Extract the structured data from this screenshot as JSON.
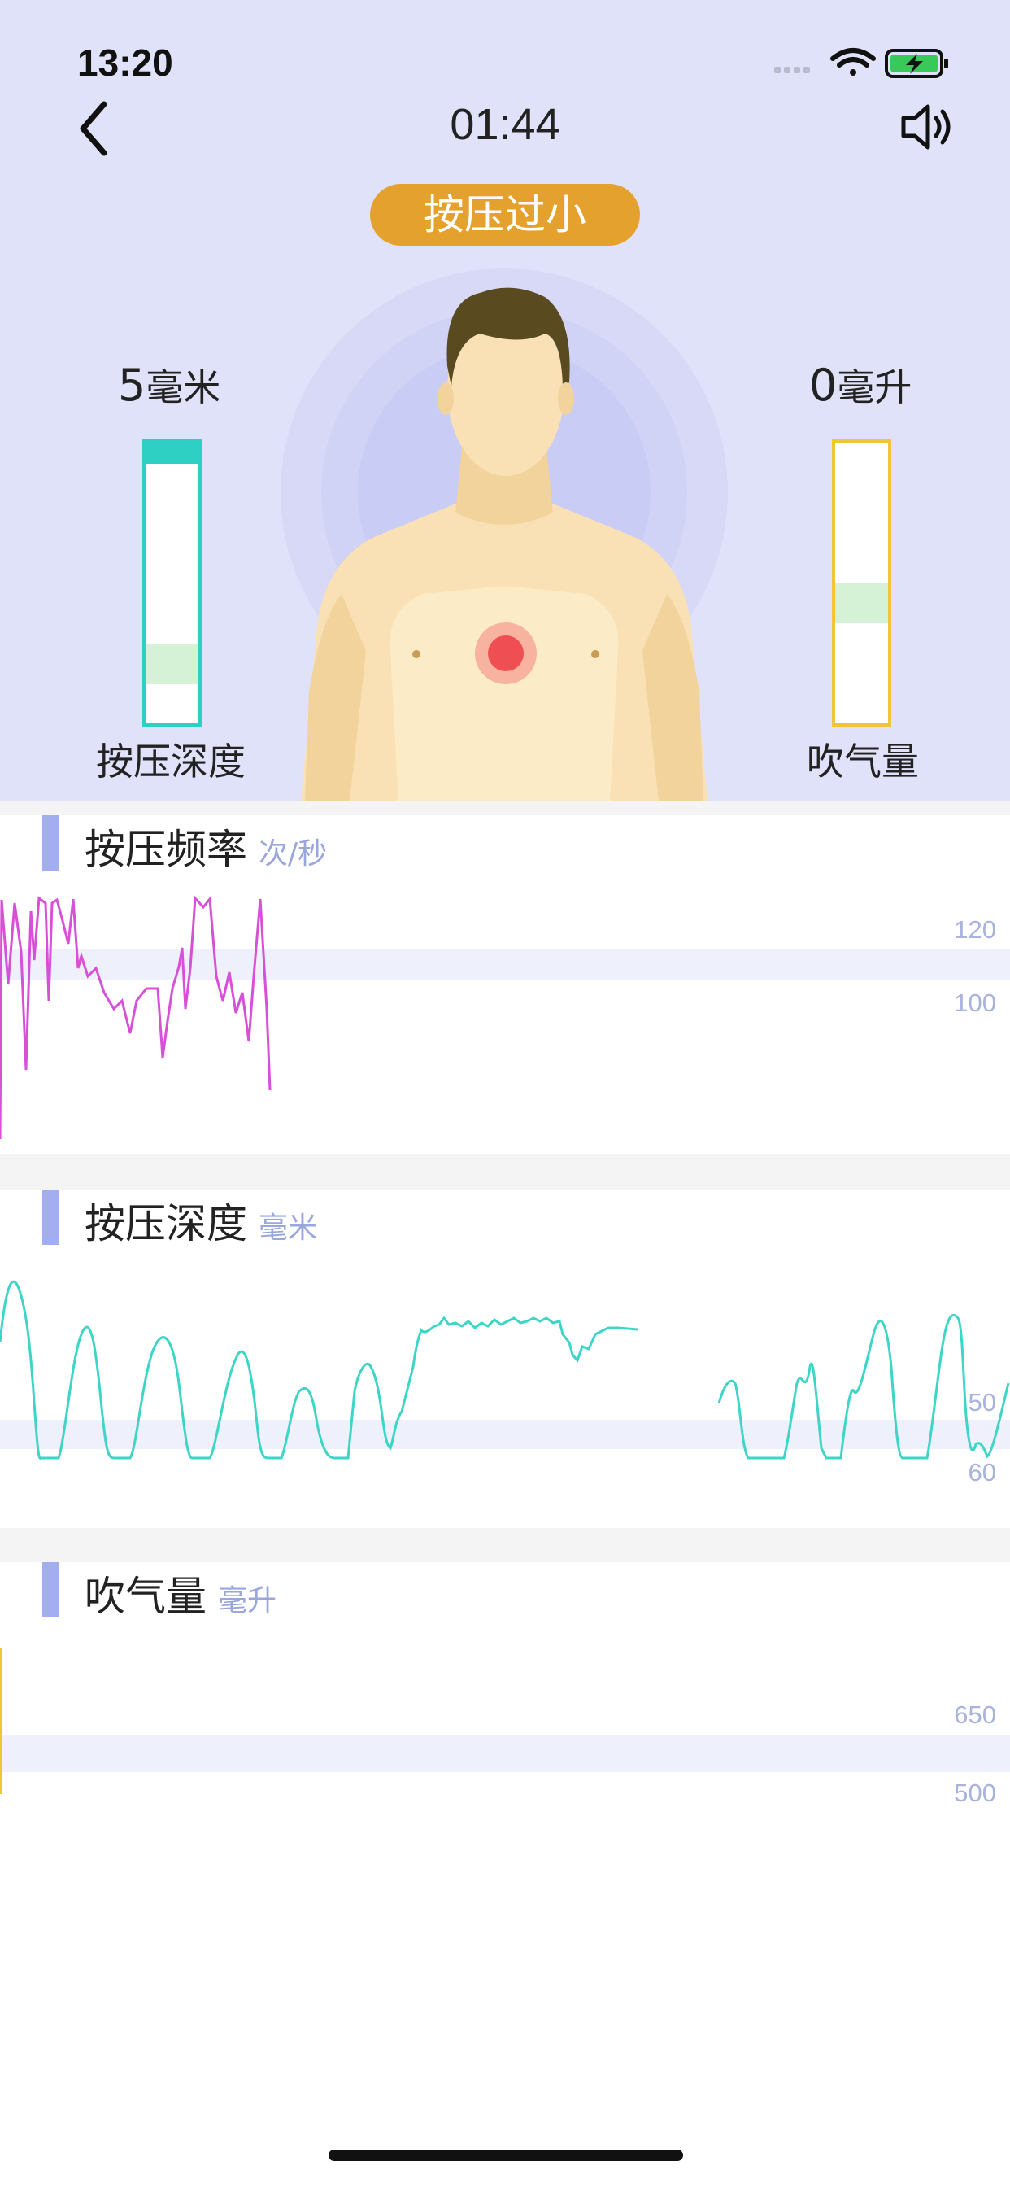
{
  "status_bar": {
    "time": "13:20"
  },
  "header": {
    "timer": "01:44"
  },
  "badge": {
    "text": "按压过小"
  },
  "gauges": {
    "depth": {
      "value": "5",
      "unit": "毫米",
      "label": "按压深度",
      "color": "#2fd0c4",
      "target_band_color": "#d6f2d6"
    },
    "volume": {
      "value": "0",
      "unit": "毫升",
      "label": "吹气量",
      "color": "#f0c537",
      "target_band_color": "#d6f2d6"
    }
  },
  "sections": {
    "rate": {
      "title": "按压频率",
      "unit": "次/秒",
      "axis_top": "120",
      "axis_bottom": "100",
      "line_color": "#d84fd8"
    },
    "depth": {
      "title": "按压深度",
      "unit": "毫米",
      "axis_top": "50",
      "axis_bottom": "60",
      "line_color": "#3dd6c6"
    },
    "volume": {
      "title": "吹气量",
      "unit": "毫升",
      "axis_top": "650",
      "axis_bottom": "500",
      "line_color": "#f0c537"
    }
  },
  "icons": {
    "back": "chevron-left-icon",
    "sound": "speaker-icon",
    "signal": "cellular-signal-icon",
    "wifi": "wifi-icon",
    "battery": "battery-charging-icon"
  }
}
